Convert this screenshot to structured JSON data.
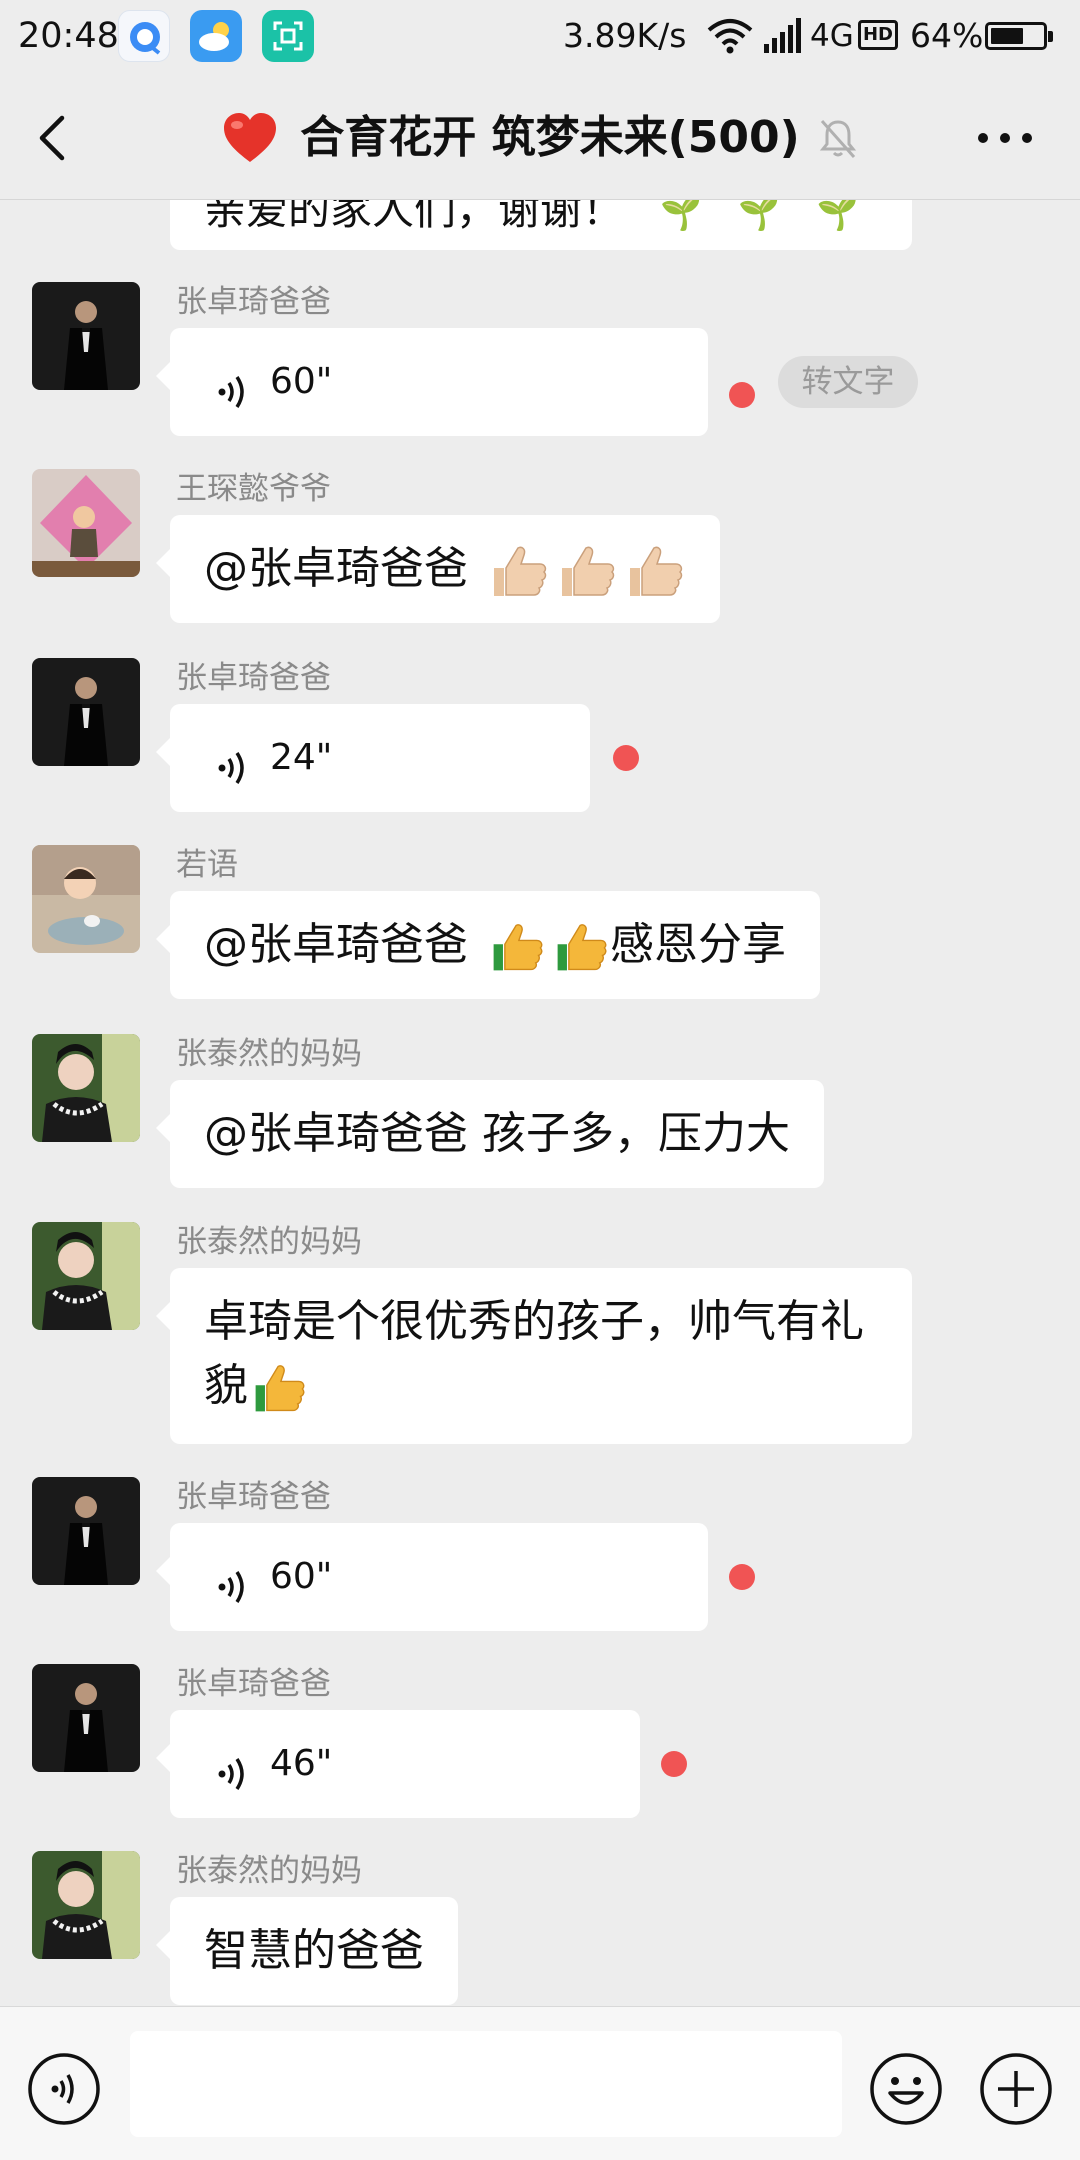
{
  "status_bar": {
    "time": "20:48",
    "net_speed": "3.89K/s",
    "network": "4G",
    "hd": "HD",
    "battery_pct": "64%",
    "battery_level": 0.64,
    "icons": [
      "browser-app-icon",
      "weather-app-icon",
      "scanner-app-icon",
      "wifi-icon",
      "signal-icon",
      "hd-icon",
      "battery-icon"
    ]
  },
  "header": {
    "title": "合育花开 筑梦未来(500)",
    "icons": [
      "back-arrow-icon",
      "heart-icon",
      "mute-bell-icon",
      "more-icon"
    ]
  },
  "partial_message": {
    "text": "亲爱的家人们，谢谢！"
  },
  "messages": [
    {
      "sender": "张卓琦爸爸",
      "type": "voice",
      "duration": "60\"",
      "unread": true,
      "to_text_label": "转文字"
    },
    {
      "sender": "王琛懿爷爷",
      "type": "text",
      "text": "@张卓琦爸爸 ",
      "emoji": [
        "thumbs-up",
        "thumbs-up",
        "thumbs-up"
      ]
    },
    {
      "sender": "张卓琦爸爸",
      "type": "voice",
      "duration": "24\"",
      "unread": true
    },
    {
      "sender": "若语",
      "type": "text",
      "text": "@张卓琦爸爸 ",
      "emoji": [
        "thumbs-up",
        "thumbs-up"
      ],
      "text_after": "感恩分享"
    },
    {
      "sender": "张泰然的妈妈",
      "type": "text",
      "text": "@张卓琦爸爸  孩子多，压力大"
    },
    {
      "sender": "张泰然的妈妈",
      "type": "text",
      "text_line1": "卓琦是个很优秀的孩子，帅气有礼",
      "text_line2": "貌",
      "emoji": [
        "thumbs-up"
      ]
    },
    {
      "sender": "张卓琦爸爸",
      "type": "voice",
      "duration": "60\"",
      "unread": true
    },
    {
      "sender": "张卓琦爸爸",
      "type": "voice",
      "duration": "46\"",
      "unread": true
    },
    {
      "sender": "张泰然的妈妈",
      "type": "text",
      "text": "智慧的爸爸"
    }
  ],
  "input_bar": {
    "value": "",
    "icons": [
      "voice-toggle-icon",
      "emoji-icon",
      "plus-icon"
    ]
  },
  "colors": {
    "background": "#ededed",
    "bubble": "#ffffff",
    "unread_dot": "#f05454",
    "sender_name": "#8a8a8a"
  }
}
